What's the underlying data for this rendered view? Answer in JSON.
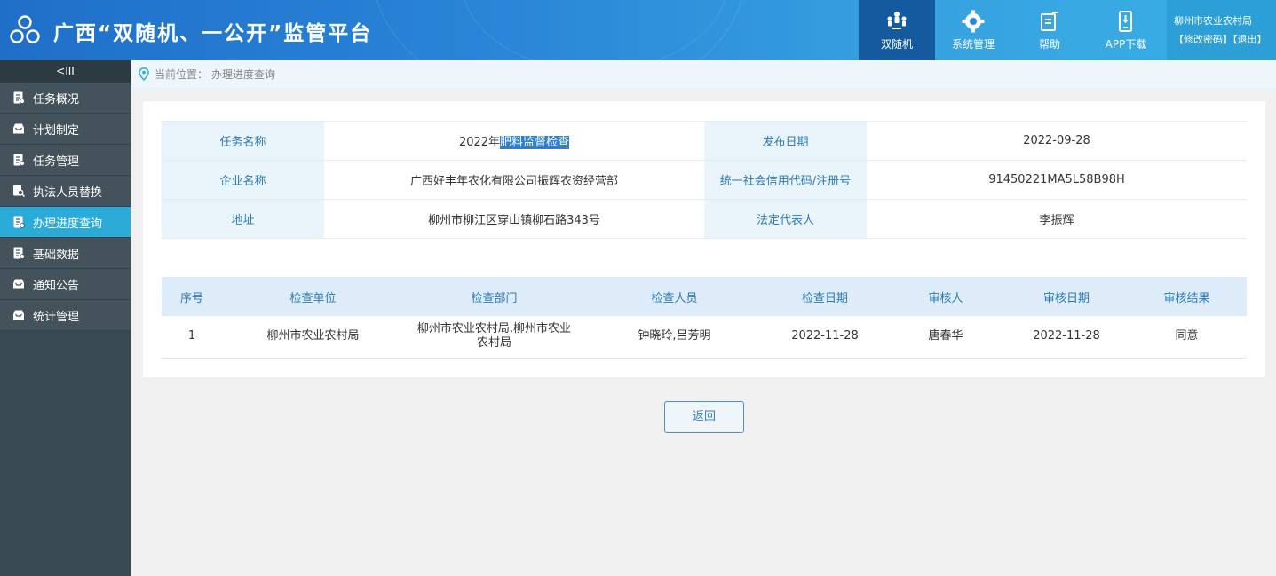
{
  "header": {
    "title": "广西“双随机、一公开”监管平台",
    "nav": [
      {
        "label": "双随机",
        "icon": "people-network-icon",
        "active": true
      },
      {
        "label": "系统管理",
        "icon": "gear-icon",
        "active": false
      },
      {
        "label": "帮助",
        "icon": "edit-document-icon",
        "active": false
      },
      {
        "label": "APP下载",
        "icon": "phone-download-icon",
        "active": false
      }
    ],
    "user": {
      "name": "柳州市农业农村局",
      "change_password": "【修改密码】",
      "logout": "【退出】"
    }
  },
  "sidebar": {
    "collapse_label": "<III",
    "items": [
      {
        "label": "任务概况",
        "icon": "document-icon",
        "active": false
      },
      {
        "label": "计划制定",
        "icon": "inbox-icon",
        "active": false
      },
      {
        "label": "任务管理",
        "icon": "document-icon",
        "active": false
      },
      {
        "label": "执法人员替换",
        "icon": "document-search-icon",
        "active": false
      },
      {
        "label": "办理进度查询",
        "icon": "document-icon",
        "active": true
      },
      {
        "label": "基础数据",
        "icon": "document-icon",
        "active": false
      },
      {
        "label": "通知公告",
        "icon": "inbox-icon",
        "active": false
      },
      {
        "label": "统计管理",
        "icon": "inbox-icon",
        "active": false
      }
    ]
  },
  "breadcrumb": {
    "prefix": "当前位置：",
    "current": "办理进度查询"
  },
  "info": {
    "task_name_label": "任务名称",
    "task_name_prefix": "2022年",
    "task_name_selected": "肥料监督检查",
    "publish_date_label": "发布日期",
    "publish_date": "2022-09-28",
    "company_label": "企业名称",
    "company": "广西好丰年农化有限公司振辉农资经营部",
    "credit_code_label": "统一社会信用代码/注册号",
    "credit_code": "91450221MA5L58B98H",
    "address_label": "地址",
    "address": "柳州市柳江区穿山镇柳石路343号",
    "legal_rep_label": "法定代表人",
    "legal_rep": "李振辉"
  },
  "list": {
    "headers": [
      "序号",
      "检查单位",
      "检查部门",
      "检查人员",
      "检查日期",
      "审核人",
      "审核日期",
      "审核结果"
    ],
    "rows": [
      [
        "1",
        "柳州市农业农村局",
        "柳州市农业农村局,柳州市农业农村局",
        "钟晓玲,吕芳明",
        "2022-11-28",
        "唐春华",
        "2022-11-28",
        "同意"
      ]
    ]
  },
  "back_button": "返回",
  "colors": {
    "header_start": "#1f6fc8",
    "header_end": "#3ab0e4",
    "nav_active": "#155a9e",
    "sidebar": "#3a4a52",
    "sidebar_active": "#2bacd8",
    "label_text": "#2a7ab8",
    "selection": "#2b7fd8"
  }
}
